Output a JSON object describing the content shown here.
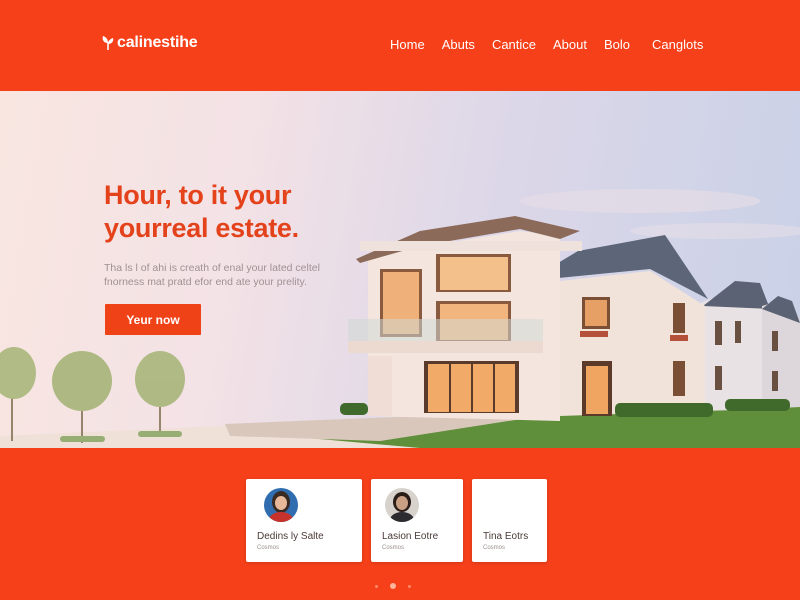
{
  "brand": {
    "name": "calinestihe",
    "accent": "#f5401a",
    "logo_icon": "leaf-icon"
  },
  "nav": {
    "items": [
      {
        "label": "Home"
      },
      {
        "label": "Abuts"
      },
      {
        "label": "Cantice"
      },
      {
        "label": "About"
      },
      {
        "label": "Bolo"
      },
      {
        "label": "Canglots"
      }
    ]
  },
  "hero": {
    "title_line1_light": "Hour, to ",
    "title_line1_bold": "it your",
    "title_line2_light": "your",
    "title_line2_bold": "real estate.",
    "subtitle": "Tha ls l of ahi is creath of enal your lated celtel fnorness mat pratd efor end ate your prelity.",
    "cta_label": "Yeur now"
  },
  "cards": [
    {
      "name": "Dedins ly Salte",
      "sub": "Cosmos",
      "avatar": "avatar-woman-1"
    },
    {
      "name": "Lasion Eotre",
      "sub": "Cosmos",
      "avatar": "avatar-woman-2"
    },
    {
      "name": "Tina Eotrs",
      "sub": "Cosmos",
      "avatar": ""
    }
  ],
  "carousel": {
    "count": 3,
    "active_index": 1
  }
}
